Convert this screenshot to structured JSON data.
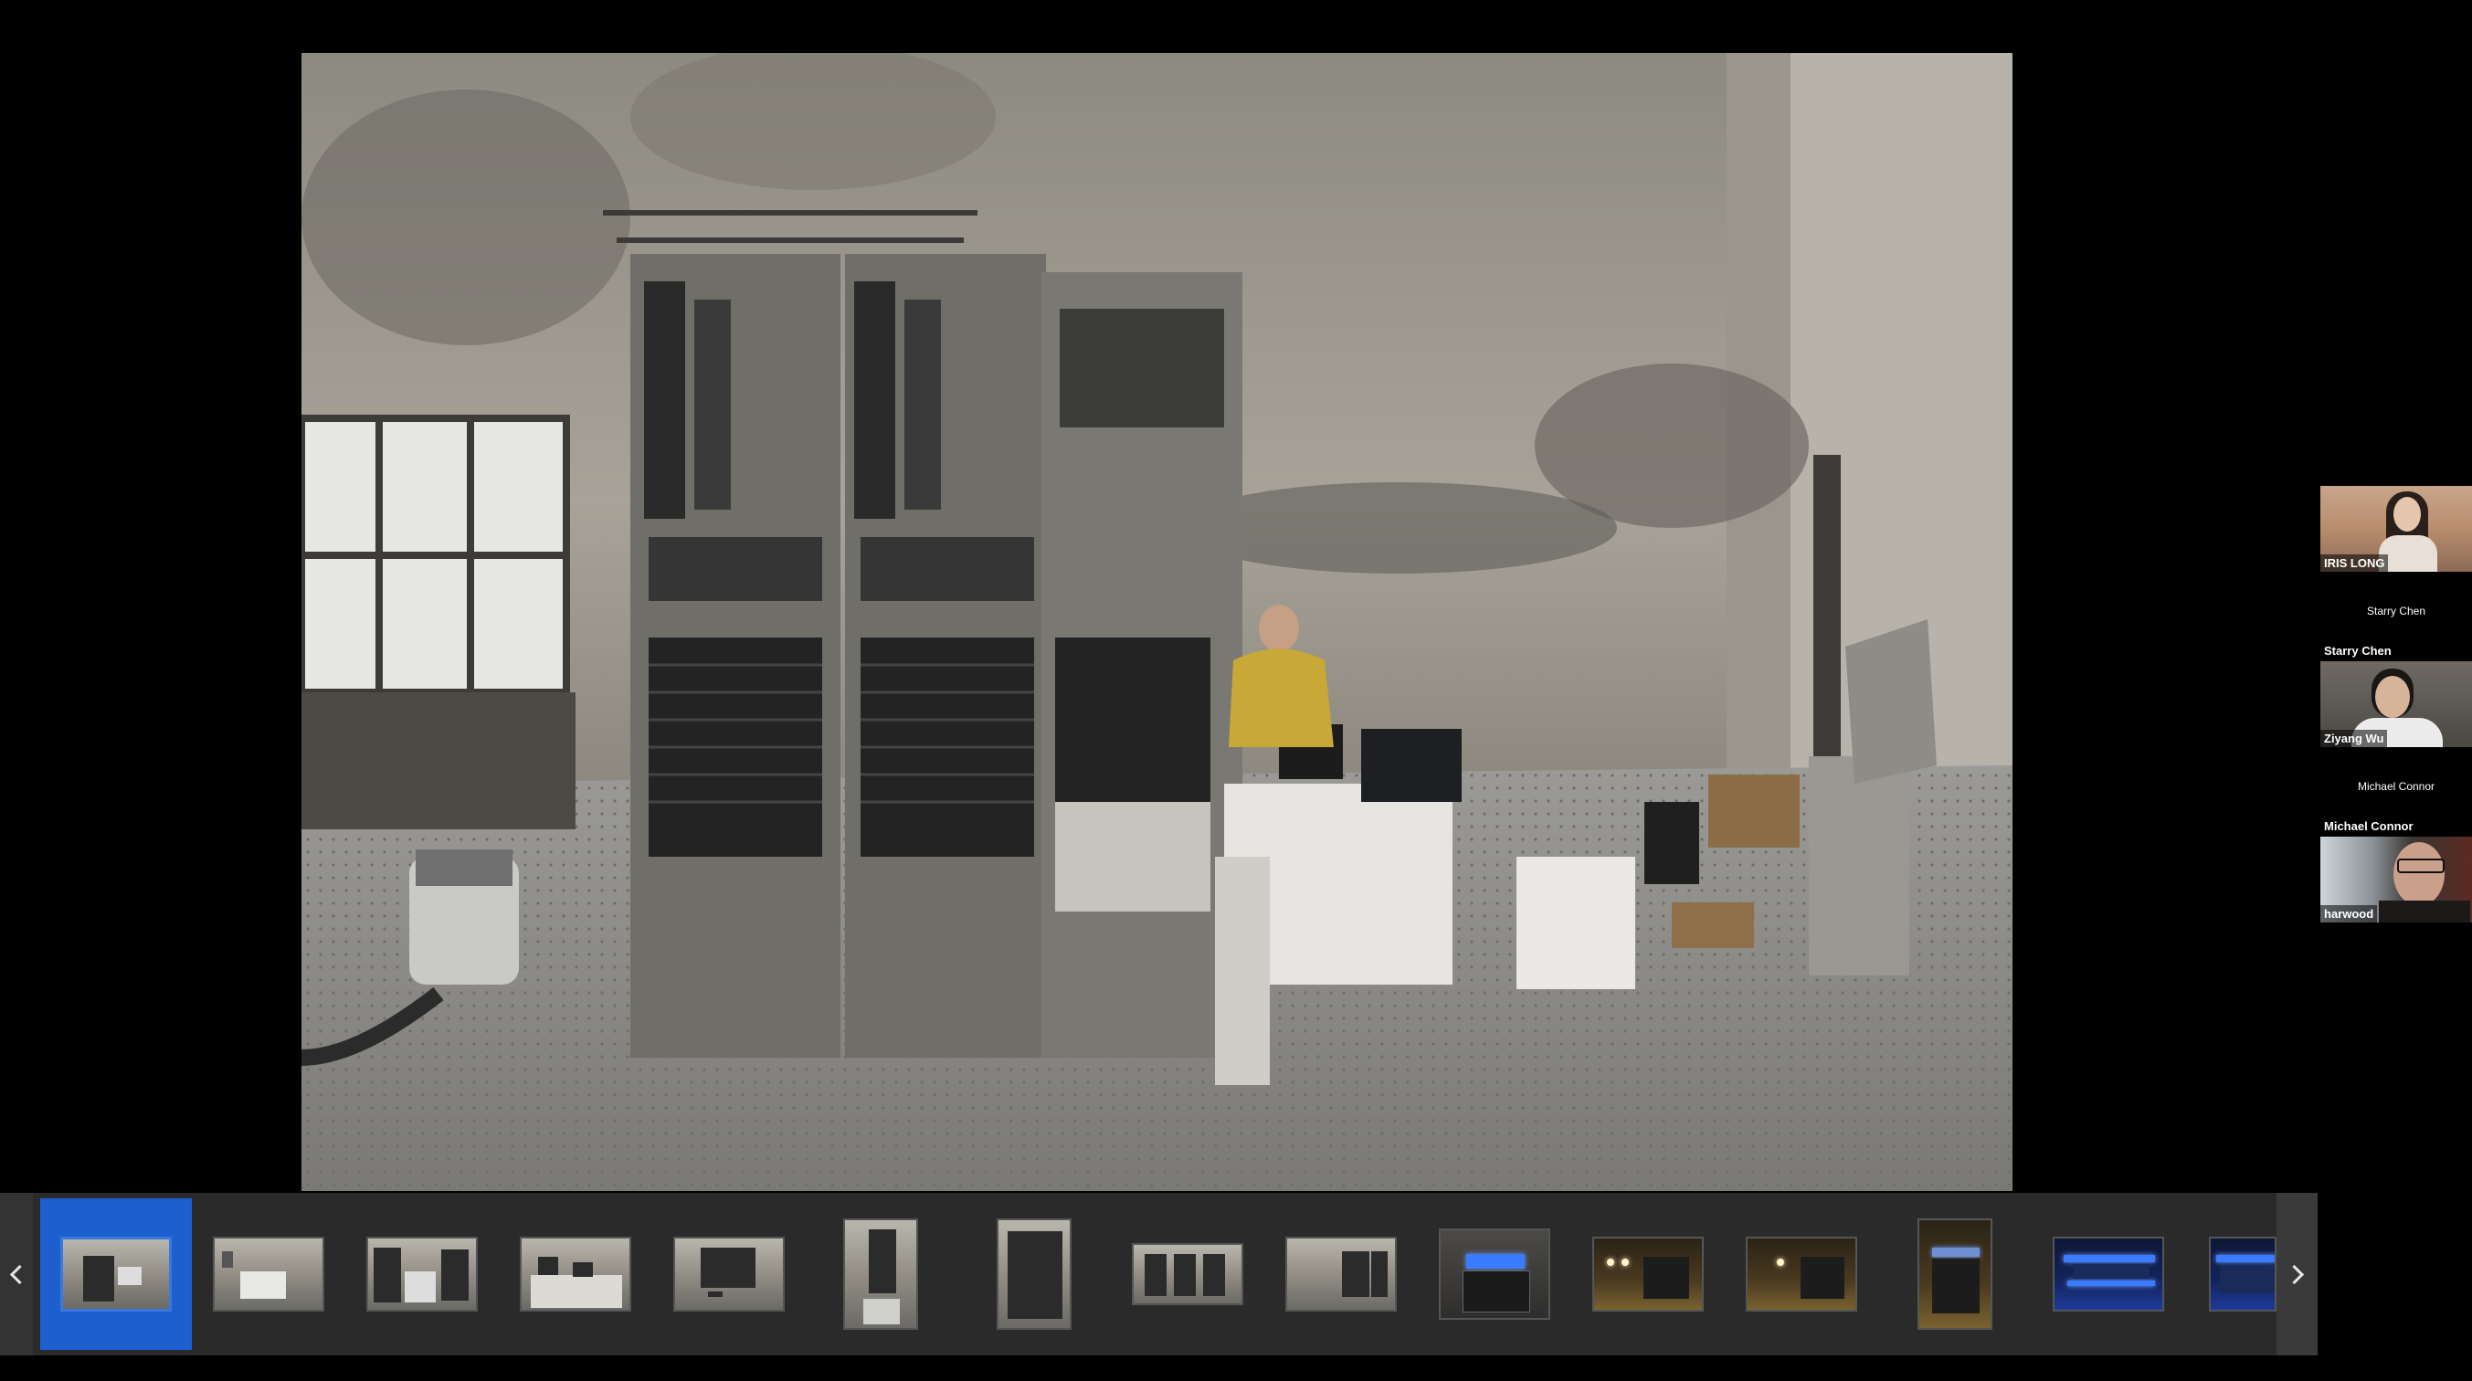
{
  "participants": [
    {
      "name": "IRIS LONG",
      "video": true
    },
    {
      "name": "Starry Chen",
      "video": false,
      "center_label": "Starry Chen"
    },
    {
      "name": "Ziyang Wu",
      "video": true
    },
    {
      "name": "Michael Connor",
      "video": false,
      "center_label": "Michael Connor"
    },
    {
      "name": "harwood",
      "video": true
    }
  ],
  "filmstrip": {
    "selected_index": 0,
    "thumbnail_count": 15,
    "prev_icon": "chevron-left-icon",
    "next_icon": "chevron-right-icon"
  },
  "colors": {
    "background": "#000000",
    "filmstrip_bg": "#2a2a2a",
    "selection_accent": "#1e5fd0"
  }
}
